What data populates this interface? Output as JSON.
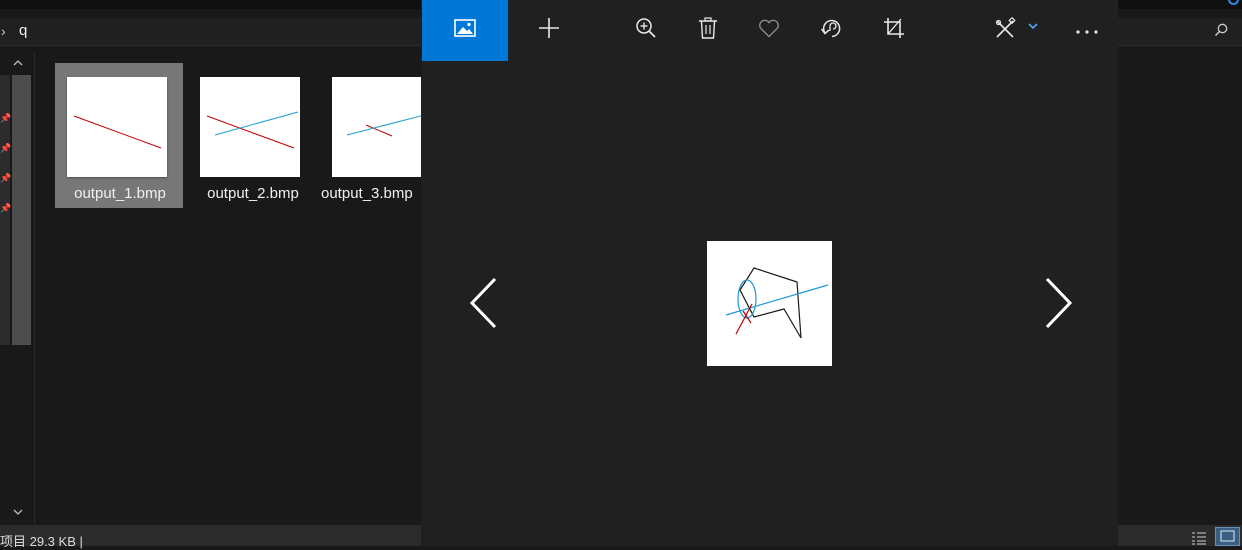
{
  "explorer": {
    "address_text": "q",
    "files": [
      {
        "name": "output_1.bmp",
        "selected": true
      },
      {
        "name": "output_2.bmp",
        "selected": false
      },
      {
        "name": "output_3.bmp",
        "selected": false
      }
    ],
    "status_text": "项目  29.3 KB  |",
    "icons": {
      "search": "search-icon",
      "pin": "pin-icon",
      "details_view": "details-view-icon",
      "thumbnail_view": "thumbnail-view-icon"
    }
  },
  "photos": {
    "toolbar": {
      "gallery": "gallery-icon",
      "add": "plus-icon",
      "zoom": "zoom-in-icon",
      "delete": "trash-icon",
      "favorite": "heart-icon",
      "rotate": "rotate-icon",
      "crop": "crop-icon",
      "edit": "edit-create-icon",
      "more": "more-icon"
    },
    "accent": "#0078d7",
    "nav": {
      "prev": "chevron-left-icon",
      "next": "chevron-right-icon"
    }
  }
}
